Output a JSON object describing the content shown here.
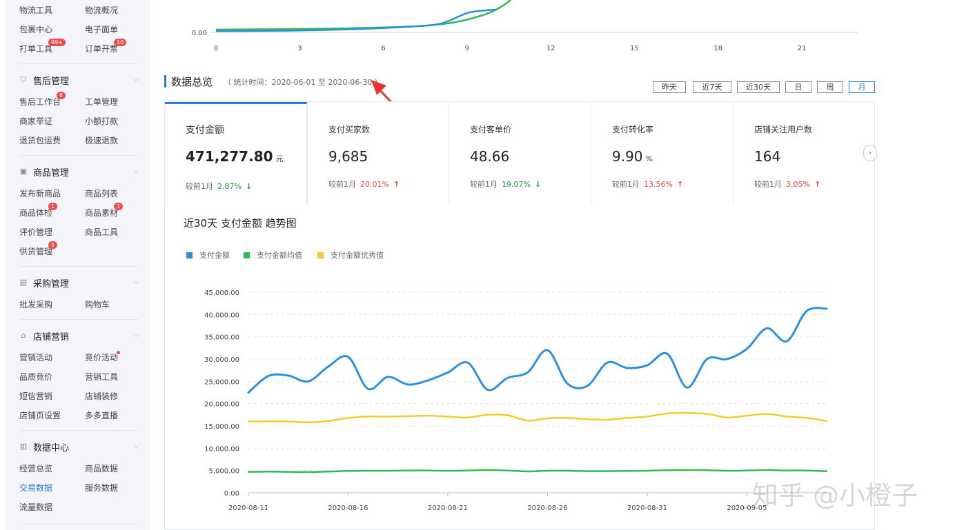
{
  "sidebar": {
    "top_items": [
      {
        "label": "物流工具",
        "badge": ""
      },
      {
        "label": "物流概况",
        "badge": ""
      },
      {
        "label": "包裹中心",
        "badge": ""
      },
      {
        "label": "电子面单",
        "badge": ""
      },
      {
        "label": "打单工具",
        "badge": "99+"
      },
      {
        "label": "订单开票",
        "badge": "10"
      }
    ],
    "sections": [
      {
        "title": "售后管理",
        "icon": "shield-check-icon",
        "items": [
          {
            "label": "售后工作台",
            "badge": "6"
          },
          {
            "label": "工单管理",
            "badge": ""
          },
          {
            "label": "商家举证",
            "badge": ""
          },
          {
            "label": "小额打款",
            "badge": ""
          },
          {
            "label": "退货包运费",
            "badge": ""
          },
          {
            "label": "极速退款",
            "badge": ""
          }
        ]
      },
      {
        "title": "商品管理",
        "icon": "box-icon",
        "items": [
          {
            "label": "发布新商品",
            "badge": ""
          },
          {
            "label": "商品列表",
            "badge": ""
          },
          {
            "label": "商品体检",
            "badge": "1"
          },
          {
            "label": "商品素材",
            "badge": "1"
          },
          {
            "label": "评价管理",
            "badge": ""
          },
          {
            "label": "商品工具",
            "badge": ""
          },
          {
            "label": "供货管理",
            "badge": "5"
          }
        ]
      },
      {
        "title": "采购管理",
        "icon": "clipboard-icon",
        "items": [
          {
            "label": "批发采购",
            "badge": ""
          },
          {
            "label": "购物车",
            "badge": ""
          }
        ]
      },
      {
        "title": "店铺营销",
        "icon": "shop-icon",
        "items": [
          {
            "label": "营销活动",
            "badge": ""
          },
          {
            "label": "竞价活动",
            "badge": "dot"
          },
          {
            "label": "品质竞价",
            "badge": ""
          },
          {
            "label": "营销工具",
            "badge": ""
          },
          {
            "label": "短信营销",
            "badge": ""
          },
          {
            "label": "店铺装修",
            "badge": ""
          },
          {
            "label": "店铺页设置",
            "badge": ""
          },
          {
            "label": "多多直播",
            "badge": ""
          }
        ]
      },
      {
        "title": "数据中心",
        "icon": "bar-chart-icon",
        "items": [
          {
            "label": "经营总览",
            "badge": ""
          },
          {
            "label": "商品数据",
            "badge": ""
          },
          {
            "label": "交易数据",
            "badge": "",
            "active": true
          },
          {
            "label": "服务数据",
            "badge": ""
          },
          {
            "label": "流量数据",
            "badge": ""
          }
        ]
      }
    ]
  },
  "top_chart": {
    "y_label": "0.00",
    "x_ticks": [
      "0",
      "3",
      "6",
      "9",
      "12",
      "15",
      "18",
      "21"
    ]
  },
  "overview": {
    "title": "数据总览",
    "subtitle": "（ 统计时间：2020-06-01 至 2020-06-30 ）",
    "ranges": [
      "昨天",
      "近7天",
      "近30天",
      "日",
      "周",
      "月"
    ],
    "selected_range": "月"
  },
  "metrics": [
    {
      "title": "支付金额",
      "value": "471,277.80",
      "unit": "元",
      "compare_label": "较前1月",
      "pct": "2.87%",
      "direction": "down"
    },
    {
      "title": "支付买家数",
      "value": "9,685",
      "unit": "",
      "compare_label": "较前1月",
      "pct": "20.01%",
      "direction": "up"
    },
    {
      "title": "支付客单价",
      "value": "48.66",
      "unit": "",
      "compare_label": "较前1月",
      "pct": "19.07%",
      "direction": "down"
    },
    {
      "title": "支付转化率",
      "value": "9.90",
      "unit": "%",
      "compare_label": "较前1月",
      "pct": "13.56%",
      "direction": "up"
    },
    {
      "title": "店铺关注用户数",
      "value": "164",
      "unit": "",
      "compare_label": "较前1月",
      "pct": "3.05%",
      "direction": "up"
    }
  ],
  "trend": {
    "title": "近30天 支付金额 趋势图"
  },
  "colors": {
    "blue": "#2b8fe0",
    "green": "#2fba54",
    "yellow": "#f2cc2a",
    "accent": "#2a7de1",
    "up": "#e34b4b",
    "down": "#229944",
    "arrow": "#e8332e"
  },
  "chart_data": {
    "type": "line",
    "title": "近30天 支付金额 趋势图",
    "x": [
      "2020-08-11",
      "2020-08-12",
      "2020-08-13",
      "2020-08-14",
      "2020-08-15",
      "2020-08-16",
      "2020-08-17",
      "2020-08-18",
      "2020-08-19",
      "2020-08-20",
      "2020-08-21",
      "2020-08-22",
      "2020-08-23",
      "2020-08-24",
      "2020-08-25",
      "2020-08-26",
      "2020-08-27",
      "2020-08-28",
      "2020-08-29",
      "2020-08-30",
      "2020-08-31",
      "2020-09-01",
      "2020-09-02",
      "2020-09-03",
      "2020-09-04",
      "2020-09-05",
      "2020-09-06",
      "2020-09-07",
      "2020-09-08",
      "2020-09-09"
    ],
    "x_ticks": [
      "2020-08-11",
      "2020-08-16",
      "2020-08-21",
      "2020-08-26",
      "2020-08-31",
      "2020-09-05"
    ],
    "y_ticks": [
      "0.00",
      "5,000.00",
      "10,000.00",
      "15,000.00",
      "20,000.00",
      "25,000.00",
      "30,000.00",
      "35,000.00",
      "40,000.00",
      "45,000.00"
    ],
    "ylim": [
      0,
      45000
    ],
    "legend_position": "top-left",
    "grid": true,
    "series": [
      {
        "name": "支付金额",
        "color": "#2b8fe0",
        "values": [
          22500,
          26200,
          26300,
          25000,
          28300,
          30500,
          23300,
          26000,
          24300,
          25200,
          27000,
          29200,
          23100,
          25800,
          27000,
          32000,
          24500,
          24000,
          29200,
          28000,
          28600,
          31200,
          23600,
          30000,
          30000,
          32300,
          36900,
          34000,
          40800,
          41300
        ]
      },
      {
        "name": "支付金额均值",
        "color": "#2fba54",
        "values": [
          4700,
          4750,
          4700,
          4650,
          4750,
          4900,
          4950,
          4950,
          5000,
          5000,
          4950,
          5000,
          5100,
          5000,
          4800,
          4950,
          4950,
          4850,
          4850,
          4900,
          4950,
          5050,
          5100,
          5050,
          4950,
          5000,
          5100,
          5000,
          5000,
          4850
        ]
      },
      {
        "name": "支付金额优秀值",
        "color": "#f2cc2a",
        "values": [
          16000,
          16000,
          16000,
          15800,
          16100,
          16800,
          17100,
          17100,
          17200,
          17300,
          17100,
          16900,
          17500,
          17400,
          16200,
          16700,
          16800,
          16500,
          16400,
          16800,
          17100,
          17800,
          17900,
          17700,
          16900,
          17300,
          17700,
          17100,
          16800,
          16100
        ]
      }
    ]
  },
  "watermark": "知乎 @小橙子"
}
